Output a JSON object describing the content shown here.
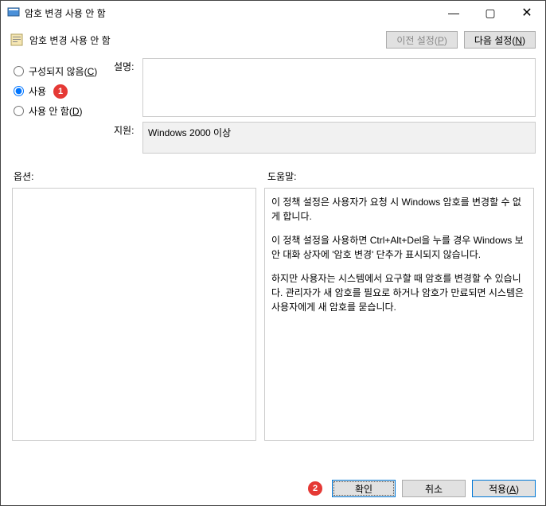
{
  "window": {
    "title": "암호 변경 사용 안 함"
  },
  "header": {
    "title": "암호 변경 사용 안 함",
    "prev_label": "이전 설정",
    "prev_accel": "P",
    "next_label": "다음 설정",
    "next_accel": "N"
  },
  "radios": {
    "notconfigured_label": "구성되지 않음",
    "notconfigured_accel": "C",
    "enabled_label": "사용",
    "disabled_label": "사용 안 함",
    "disabled_accel": "D",
    "selected": "enabled"
  },
  "fields": {
    "description_label": "설명:",
    "description_value": "",
    "support_label": "지원:",
    "support_value": "Windows 2000 이상"
  },
  "labels": {
    "options": "옵션:",
    "help": "도움말:"
  },
  "help": {
    "p1": "이 정책 설정은 사용자가 요청 시 Windows 암호를 변경할 수 없게 합니다.",
    "p2": "이 정책 설정을 사용하면 Ctrl+Alt+Del을 누를 경우 Windows 보안 대화 상자에 '암호 변경' 단추가 표시되지 않습니다.",
    "p3": "하지만 사용자는 시스템에서 요구할 때 암호를 변경할 수 있습니다. 관리자가 새 암호를 필요로 하거나 암호가 만료되면 시스템은 사용자에게 새 암호를 묻습니다."
  },
  "footer": {
    "ok_label": "확인",
    "cancel_label": "취소",
    "apply_label": "적용",
    "apply_accel": "A"
  },
  "markers": {
    "m1": "1",
    "m2": "2"
  }
}
